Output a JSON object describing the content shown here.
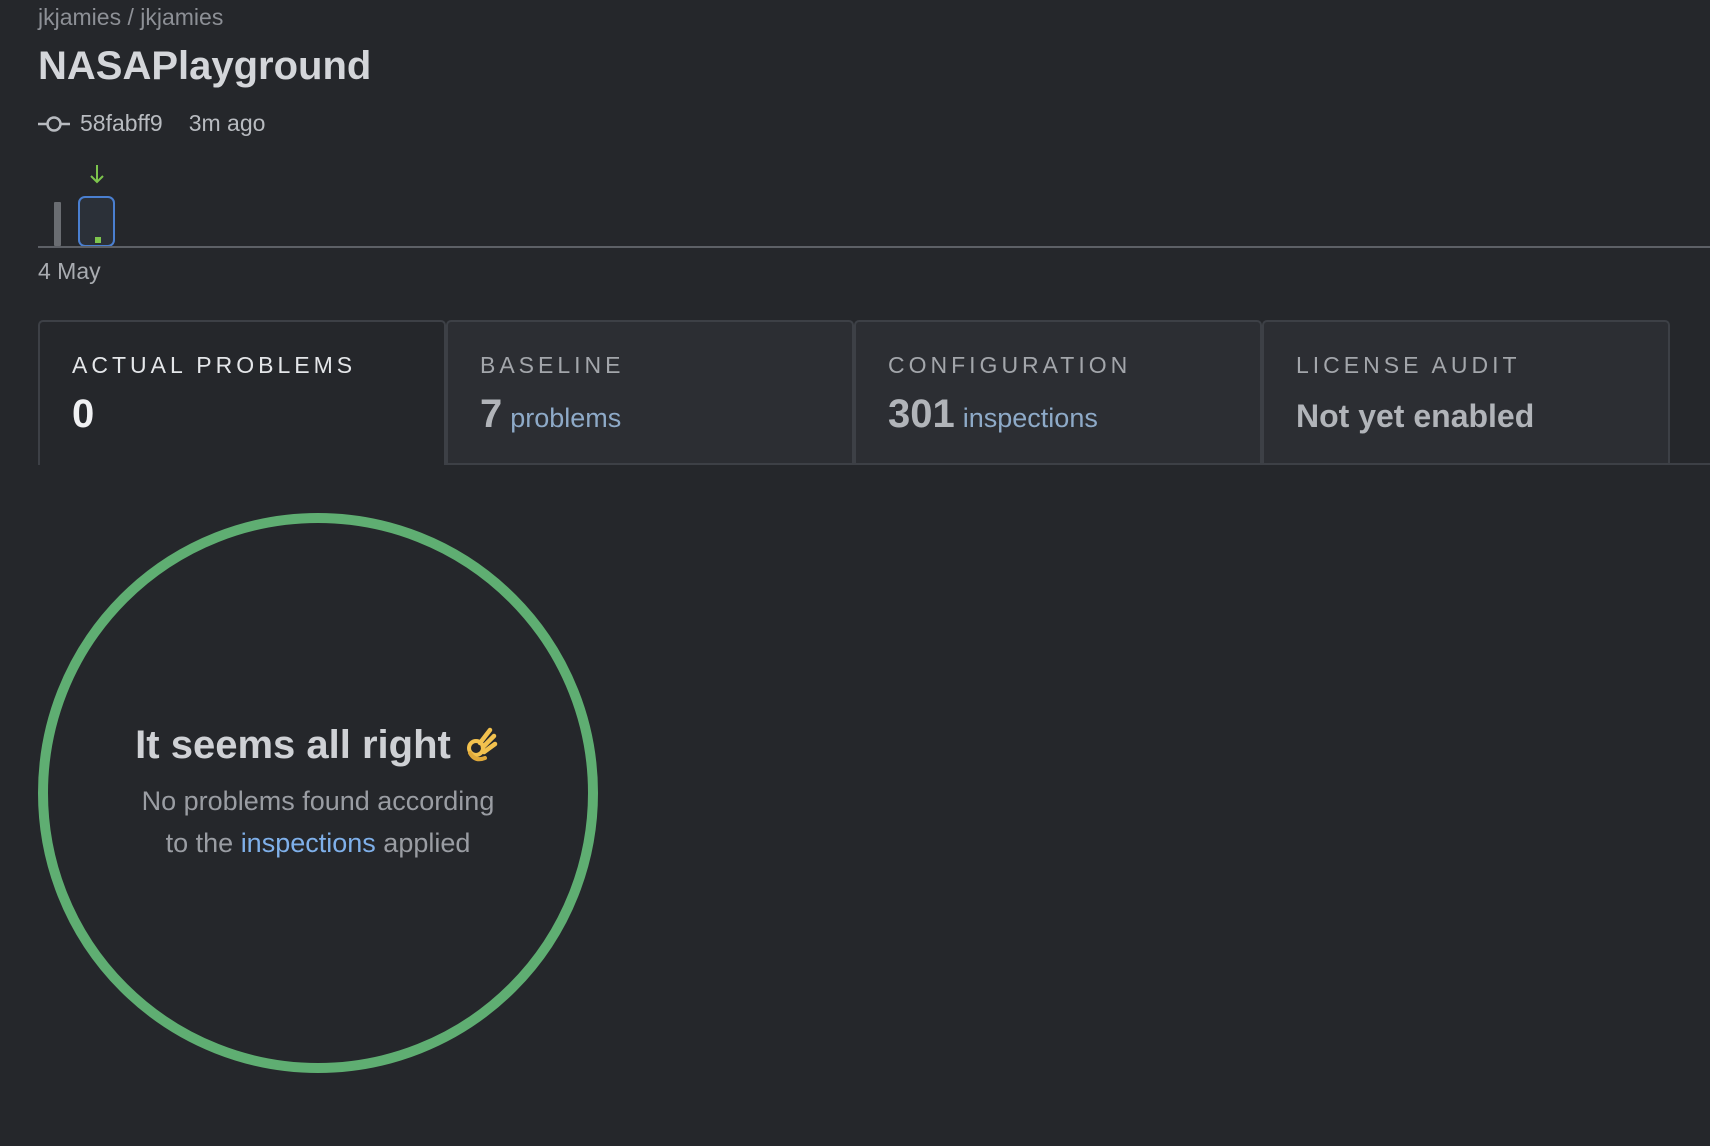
{
  "header": {
    "breadcrumb": "jkjamies / jkjamies",
    "title": "NASAPlayground",
    "commit_hash": "58fabff9",
    "commit_time": "3m ago"
  },
  "timeline": {
    "date_label": "4 May",
    "arrow_icon": "arrow-down-icon",
    "accent_color": "#7dc54d",
    "selected_color": "#4a7fd0"
  },
  "tabs": [
    {
      "label": "ACTUAL PROBLEMS",
      "value": "0",
      "unit": ""
    },
    {
      "label": "BASELINE",
      "value": "7",
      "unit": "problems"
    },
    {
      "label": "CONFIGURATION",
      "value": "301",
      "unit": "inspections"
    },
    {
      "label": "LICENSE AUDIT",
      "status": "Not yet enabled"
    }
  ],
  "status": {
    "title": "It seems all right",
    "emoji_icon": "ok-hand-icon",
    "line1": "No problems found according",
    "line2_prefix": "to the",
    "link_text": "inspections",
    "line2_suffix": "applied",
    "ring_color": "#5fae72"
  }
}
